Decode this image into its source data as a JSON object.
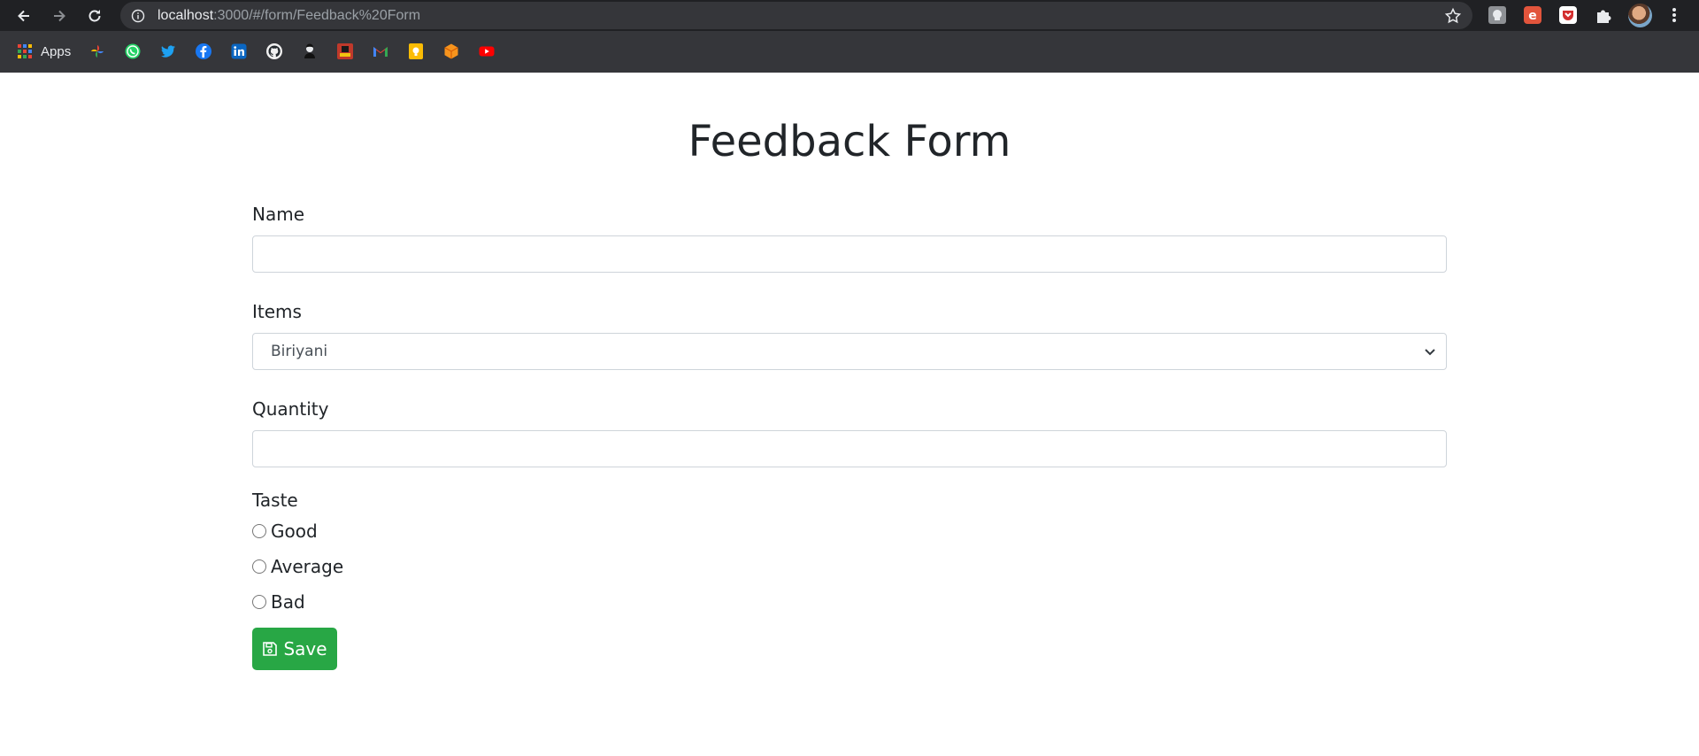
{
  "browser": {
    "url_host": "localhost",
    "url_path": ":3000/#/form/Feedback%20Form",
    "apps_label": "Apps",
    "bookmark_icons": [
      "google-photos-icon",
      "whatsapp-icon",
      "twitter-icon",
      "facebook-icon",
      "linkedin-icon",
      "github-icon",
      "avatar-bookmark-icon",
      "site-icon",
      "gmail-icon",
      "keep-icon",
      "package-icon",
      "youtube-icon"
    ],
    "extension_icons": [
      "ext-gray-icon",
      "ext-red-e-icon",
      "ext-pocket-icon",
      "puzzle-icon"
    ]
  },
  "page": {
    "title": "Feedback Form"
  },
  "form": {
    "name": {
      "label": "Name",
      "value": "",
      "placeholder": ""
    },
    "items": {
      "label": "Items",
      "selected": "Biriyani"
    },
    "quantity": {
      "label": "Quantity",
      "value": "",
      "placeholder": ""
    },
    "taste": {
      "label": "Taste",
      "options": [
        "Good",
        "Average",
        "Bad"
      ]
    },
    "save_label": "Save"
  },
  "colors": {
    "chrome_dark": "#202124",
    "chrome_bar": "#35363a",
    "save_green": "#28a745",
    "text": "#212529",
    "border": "#ced4da"
  }
}
